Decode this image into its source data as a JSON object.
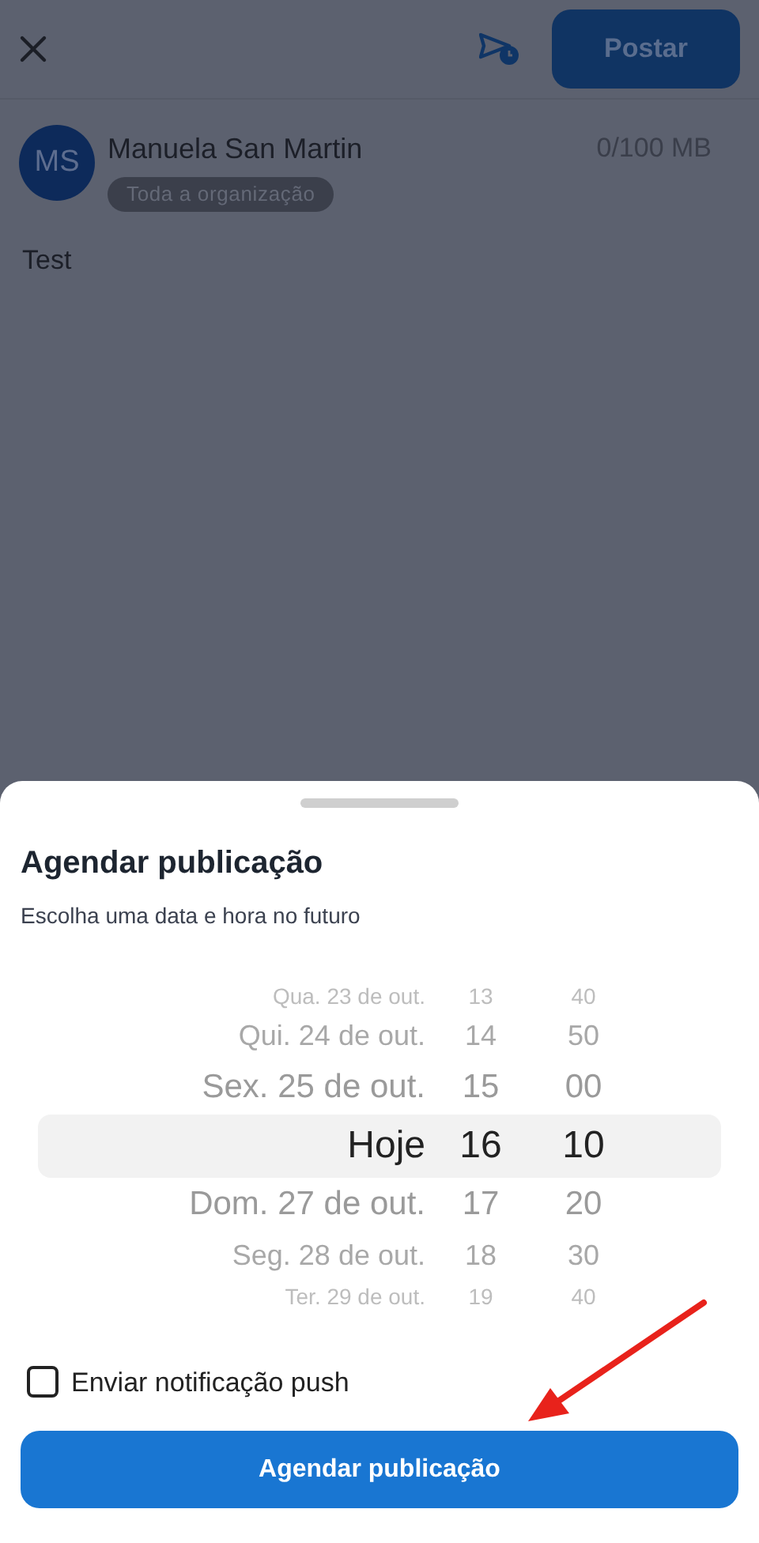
{
  "top_bar": {
    "post_button": "Postar"
  },
  "author": {
    "initials": "MS",
    "name": "Manuela San Martin",
    "audience": "Toda a organização",
    "storage": "0/100 MB"
  },
  "post_text": "Test",
  "sheet": {
    "title": "Agendar publicação",
    "subtitle": "Escolha uma data e hora no futuro",
    "picker_rows": [
      {
        "date": "Qua. 23 de out.",
        "hour": "13",
        "minute": "40",
        "selected": false
      },
      {
        "date": "Qui. 24 de out.",
        "hour": "14",
        "minute": "50",
        "selected": false
      },
      {
        "date": "Sex. 25 de out.",
        "hour": "15",
        "minute": "00",
        "selected": false
      },
      {
        "date": "Hoje",
        "hour": "16",
        "minute": "10",
        "selected": true
      },
      {
        "date": "Dom. 27 de out.",
        "hour": "17",
        "minute": "20",
        "selected": false
      },
      {
        "date": "Seg. 28 de out.",
        "hour": "18",
        "minute": "30",
        "selected": false
      },
      {
        "date": "Ter. 29 de out.",
        "hour": "19",
        "minute": "40",
        "selected": false
      }
    ],
    "push_notification": {
      "label": "Enviar notificação push",
      "checked": false
    },
    "submit_button": "Agendar publicação"
  }
}
